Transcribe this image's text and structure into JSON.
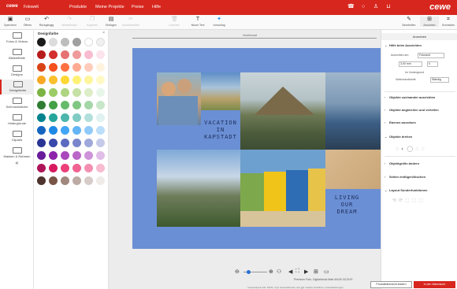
{
  "topbar": {
    "logo": "cewe",
    "product": "Fotowelt",
    "nav": [
      "Produkte",
      "Meine Projekte",
      "Preise",
      "Hilfe"
    ],
    "brand": "cewe",
    "icons": [
      "phone-icon",
      "help-icon",
      "user-icon",
      "cart-icon"
    ]
  },
  "toolbar": {
    "items": [
      {
        "label": "Speichern",
        "enabled": true
      },
      {
        "label": "Öffnen",
        "enabled": true
      },
      {
        "label": "Rückgängig",
        "enabled": true
      },
      {
        "label": "Wiederholen",
        "enabled": false
      },
      {
        "label": "Kopieren",
        "enabled": false
      },
      {
        "label": "Einfügen",
        "enabled": true
      },
      {
        "label": "Ausschneiden",
        "enabled": false
      },
      {
        "label": "Löschen",
        "enabled": false
      },
      {
        "label": "Neuer Text",
        "enabled": true
      },
      {
        "label": "Vorschlag",
        "enabled": true
      }
    ],
    "right_items": [
      "Bearbeiten",
      "Anordnen",
      "Schneiden"
    ]
  },
  "sidebar": {
    "items": [
      {
        "label": "Fotos & Videos",
        "active": false
      },
      {
        "label": "Bildeeffekte",
        "active": false
      },
      {
        "label": "Designs",
        "active": false
      },
      {
        "label": "Designfarbe",
        "active": true
      },
      {
        "label": "Schmuckstücke",
        "active": false
      },
      {
        "label": "Hintergründe",
        "active": false
      },
      {
        "label": "Cliparts",
        "active": false
      },
      {
        "label": "Masken & Rahmen",
        "active": false
      }
    ],
    "collapse": "«"
  },
  "panel": {
    "title": "Designfarbe",
    "swatch_colors": [
      "#1a1a1a",
      "#dcdcdc",
      "#bdbdbd",
      "#a0a0a0",
      "#ffffff",
      "#f0f0f0",
      "#b71c1c",
      "#d32f2f",
      "#e57373",
      "#ef9a9a",
      "#f8bbd0",
      "#fce4ec",
      "#d84315",
      "#f4511e",
      "#ff7043",
      "#ffab91",
      "#ffccbc",
      "#fff3e0",
      "#f9a825",
      "#fbc02d",
      "#fdd835",
      "#fff176",
      "#fff59d",
      "#fff9c4",
      "#7cb342",
      "#9ccc65",
      "#aed581",
      "#c5e1a5",
      "#dcedc8",
      "#e8f5e9",
      "#2e7d32",
      "#43a047",
      "#66bb6a",
      "#81c784",
      "#a5d6a7",
      "#c8e6c9",
      "#00838f",
      "#26a69a",
      "#4db6ac",
      "#80cbc4",
      "#b2dfdb",
      "#e0f2f1",
      "#1565c0",
      "#1e88e5",
      "#42a5f5",
      "#64b5f6",
      "#90caf9",
      "#bbdefb",
      "#283593",
      "#3949ab",
      "#5c6bc0",
      "#7986cb",
      "#9fa8da",
      "#c5cae9",
      "#6a1b9a",
      "#8e24aa",
      "#ab47bc",
      "#ba68c8",
      "#ce93d8",
      "#e1bee7",
      "#ad1457",
      "#d81b60",
      "#ec407a",
      "#f06292",
      "#f48fb1",
      "#f8bbd0",
      "#4e342e",
      "#795548",
      "#a1887f",
      "#bcaaa4",
      "#d7ccc8",
      "#efebe9"
    ]
  },
  "canvas": {
    "ruler_label": "Hochformat",
    "texts": {
      "vacation": "VACATION\nIN\nKAPSTADT",
      "living": "LIVING\nOUR\nDREAM"
    },
    "status_line": "Premium Foto- Digitaldruck Matt 40x30 16,29 €*",
    "footnote": "* Gesamtpreis inkl. MwSt. zzgl. Versandkosten und ggf. weitere Gebühren, Zusatzleistungen"
  },
  "right_panel": {
    "tabs": [
      "Anordnen"
    ],
    "sections": [
      "Hilfe beim Ausrichten",
      "Objekte zueinander ausrichten",
      "Objekte angleichen und verteilen",
      "Ebenen anordnen",
      "Objekte drehen",
      "Objektgröße ändern",
      "Seiten einfügen/löschen",
      "Layout Sonderfunktionen"
    ],
    "align_label": "Ausrichten am",
    "align_value": "Fotorand",
    "field1": "3,00 mm",
    "field2": "0",
    "checkbox_label": "Im Vordergrund",
    "dropdown_label": "Seitenrandbreite",
    "dropdown_value": "Ständig"
  },
  "bottom": {
    "note_button": "Produktübersicht ändern",
    "cart_button": "In den Warenkorb"
  }
}
